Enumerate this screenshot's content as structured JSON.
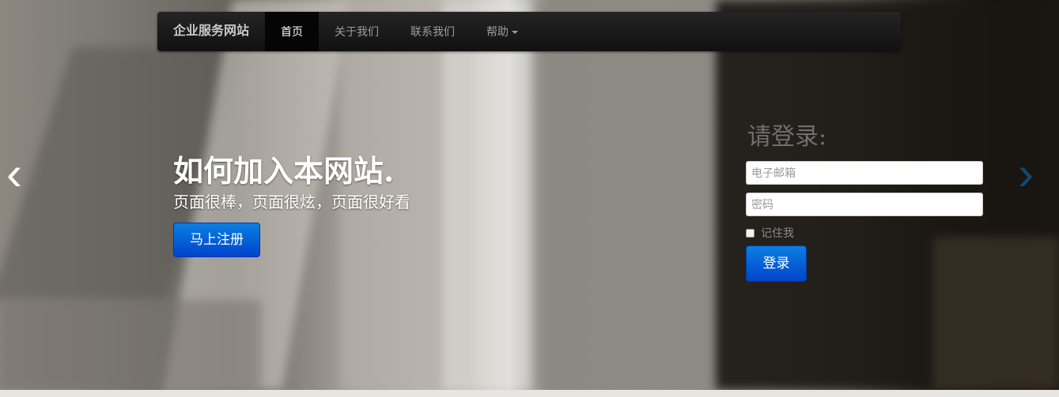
{
  "navbar": {
    "brand": "企业服务网站",
    "items": [
      {
        "label": "首页",
        "active": true
      },
      {
        "label": "关于我们"
      },
      {
        "label": "联系我们"
      },
      {
        "label": "帮助"
      }
    ]
  },
  "carousel": {
    "prev_icon": "‹",
    "next_icon": "›",
    "heading": "如何加入本网站.",
    "subheading": "页面很棒，页面很炫，页面很好看",
    "cta_label": "马上注册"
  },
  "login": {
    "title": "请登录:",
    "email_placeholder": "电子邮箱",
    "password_placeholder": "密码",
    "remember_label": "记住我",
    "submit_label": "登录"
  },
  "colors": {
    "primary": "#0055cc",
    "navbar_bg": "#1b1b1b",
    "next_arrow": "#0e4a72"
  }
}
